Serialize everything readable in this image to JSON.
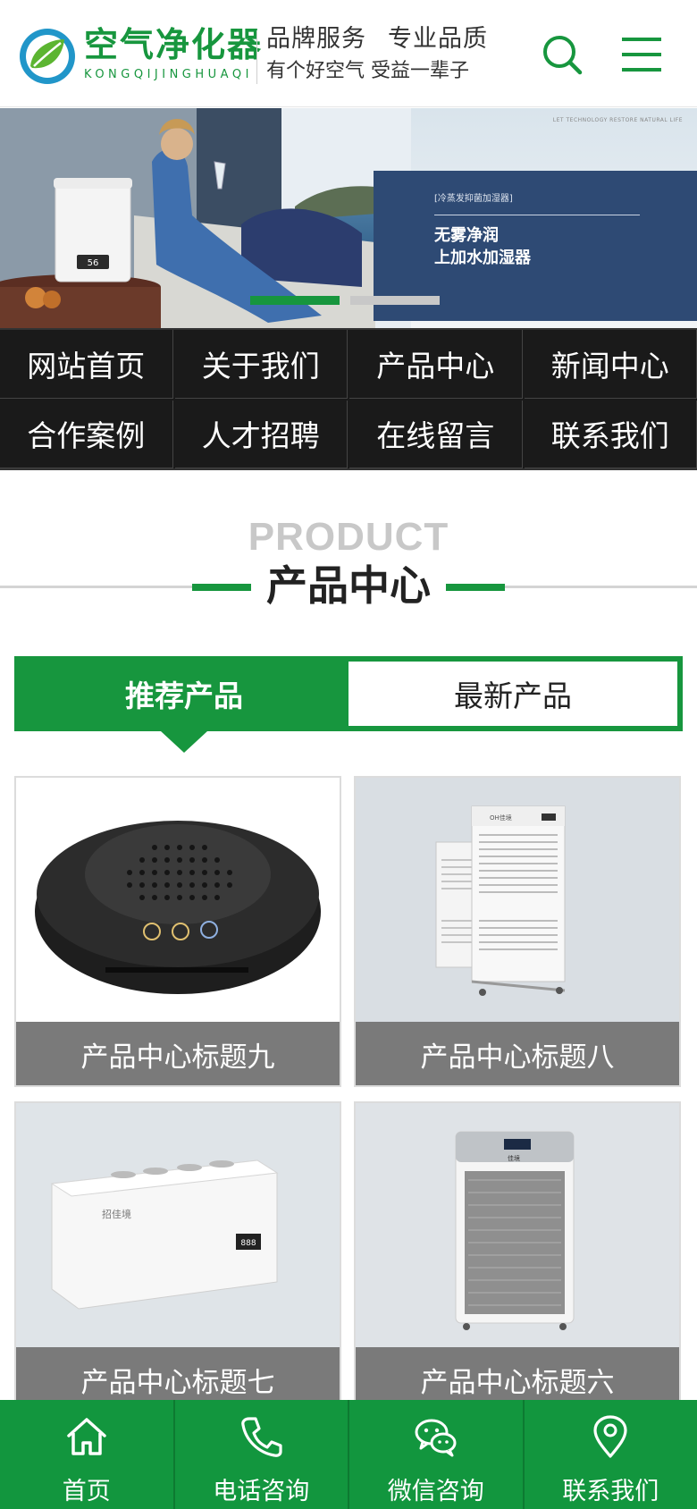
{
  "header": {
    "brand_name": "空气净化器",
    "brand_pinyin": "KONGQIJINGHUAQI",
    "slogan_line1_a": "品牌服务",
    "slogan_line1_b": "专业品质",
    "slogan_line2": "有个好空气 受益一辈子",
    "search_icon": "search-icon",
    "menu_icon": "hamburger-menu-icon"
  },
  "banner": {
    "top_note": "LET TECHNOLOGY RESTORE NATURAL LIFE",
    "tag": "[冷蒸发抑菌加湿器]",
    "headline_1": "无雾净润",
    "headline_2": "上加水加湿器",
    "device_display": "56",
    "slides": 2,
    "active_slide": 1
  },
  "nav": {
    "items": [
      {
        "label": "网站首页"
      },
      {
        "label": "关于我们"
      },
      {
        "label": "产品中心"
      },
      {
        "label": "新闻中心"
      },
      {
        "label": "合作案例"
      },
      {
        "label": "人才招聘"
      },
      {
        "label": "在线留言"
      },
      {
        "label": "联系我们"
      }
    ]
  },
  "section": {
    "en_title": "PRODUCT",
    "cn_title": "产品中心"
  },
  "tabs": {
    "active": "推荐产品",
    "inactive": "最新产品"
  },
  "products": [
    {
      "title": "产品中心标题九",
      "panel_text": ""
    },
    {
      "title": "产品中心标题八",
      "panel_text": "OH佳境"
    },
    {
      "title": "产品中心标题七",
      "panel_text": "招佳境"
    },
    {
      "title": "产品中心标题六",
      "panel_text": "佳境"
    }
  ],
  "bottom_bar": {
    "items": [
      {
        "label": "首页",
        "icon": "home-icon"
      },
      {
        "label": "电话咨询",
        "icon": "phone-icon"
      },
      {
        "label": "微信咨询",
        "icon": "wechat-icon"
      },
      {
        "label": "联系我们",
        "icon": "location-pin-icon"
      }
    ]
  },
  "colors": {
    "brand_green": "#17963e",
    "nav_bg": "#1a1a1a",
    "banner_card": "#2e4a74",
    "label_gray": "#7a7a7a"
  }
}
